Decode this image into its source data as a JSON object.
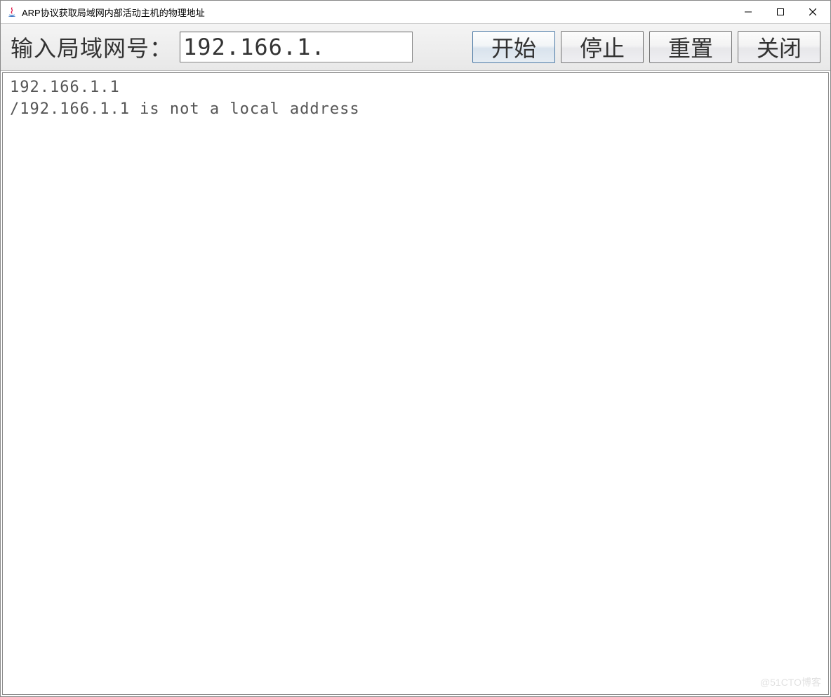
{
  "window": {
    "title": "ARP协议获取局域网内部活动主机的物理地址"
  },
  "toolbar": {
    "label": "输入局域网号：",
    "input_value": "192.166.1.",
    "buttons": {
      "start": "开始",
      "stop": "停止",
      "reset": "重置",
      "close": "关闭"
    }
  },
  "output": {
    "lines": "192.166.1.1\n/192.166.1.1 is not a local address"
  },
  "watermark": "@51CTO博客"
}
